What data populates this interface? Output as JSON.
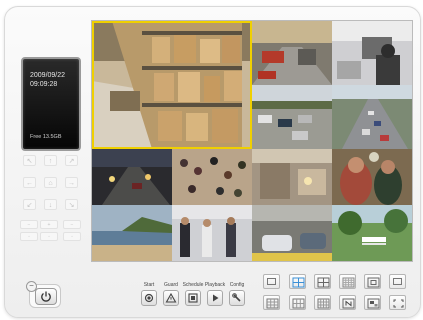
{
  "status_display": {
    "date": "2009/09/22",
    "time": "09:09:28",
    "free": "Free 13.5GB"
  },
  "ptz_pad": {
    "buttons": [
      "zoom-in",
      "tilt-up",
      "zoom-out",
      "pan-left",
      "home",
      "pan-right",
      "focus-near",
      "tilt-down",
      "focus-far",
      "iris-open",
      "iris-close",
      "preset-set",
      "preset-go",
      "patrol",
      "auto-pan"
    ]
  },
  "function_buttons": [
    {
      "label": "Start",
      "icon": "record-icon"
    },
    {
      "label": "Guard",
      "icon": "warning-icon"
    },
    {
      "label": "Schedule",
      "icon": "schedule-icon"
    },
    {
      "label": "Playback",
      "icon": "play-icon"
    },
    {
      "label": "Config",
      "icon": "wrench-icon"
    }
  ],
  "layout_buttons": {
    "row1": [
      "1x1",
      "2x2",
      "2x2-alt",
      "4x4",
      "3x3",
      "1x1-large"
    ],
    "row2": [
      "5x5",
      "3x3-grid",
      "4x4-grid",
      "sequence",
      "custom",
      "fullscreen"
    ],
    "selected": "2x2"
  },
  "camera_grid": {
    "selected_camera": "warehouse",
    "cameras": [
      "warehouse",
      "rail-station",
      "office-desk",
      "parking-lot",
      "highway",
      "street-intersection",
      "night-road",
      "crowd-plaza",
      "building-lobby",
      "crowd-close",
      "beach",
      "lab-people",
      "garage-car",
      "park-bench"
    ]
  },
  "colors": {
    "selection_border": "#f0d000",
    "active_layout": "#3a8fd6"
  }
}
